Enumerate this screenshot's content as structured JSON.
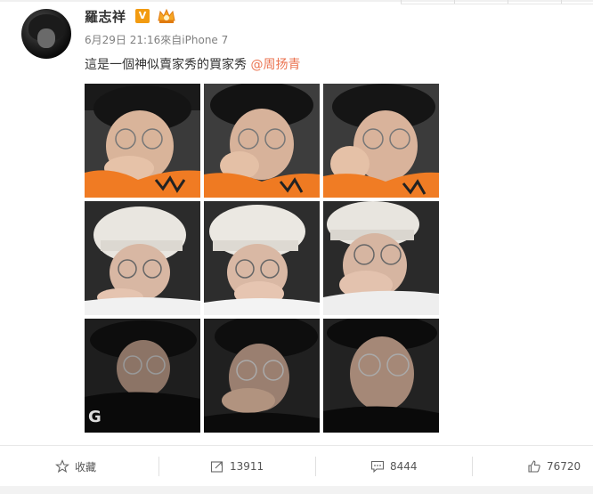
{
  "post": {
    "username": "羅志祥",
    "verified_badge": "V",
    "meta": "6月29日 21:16來自iPhone 7",
    "text": "這是一個神似賣家秀的買家秀",
    "mention": "@周扬青"
  },
  "photos": [
    {
      "id": "p1",
      "scene": "orange"
    },
    {
      "id": "p2",
      "scene": "orange"
    },
    {
      "id": "p3",
      "scene": "orange"
    },
    {
      "id": "p4",
      "scene": "white-cap"
    },
    {
      "id": "p5",
      "scene": "white-cap"
    },
    {
      "id": "p6",
      "scene": "white-cap"
    },
    {
      "id": "p7",
      "scene": "dark-hat"
    },
    {
      "id": "p8",
      "scene": "dark-hat"
    },
    {
      "id": "p9",
      "scene": "dark-hat"
    }
  ],
  "actions": {
    "collect_label": "收藏",
    "repost_count": "13911",
    "comment_count": "8444",
    "like_count": "76720"
  },
  "colors": {
    "mention": "#eb7350",
    "badge": "#f29b11"
  },
  "icons": [
    "star-icon",
    "repost-icon",
    "comment-icon",
    "thumbs-up-icon"
  ]
}
